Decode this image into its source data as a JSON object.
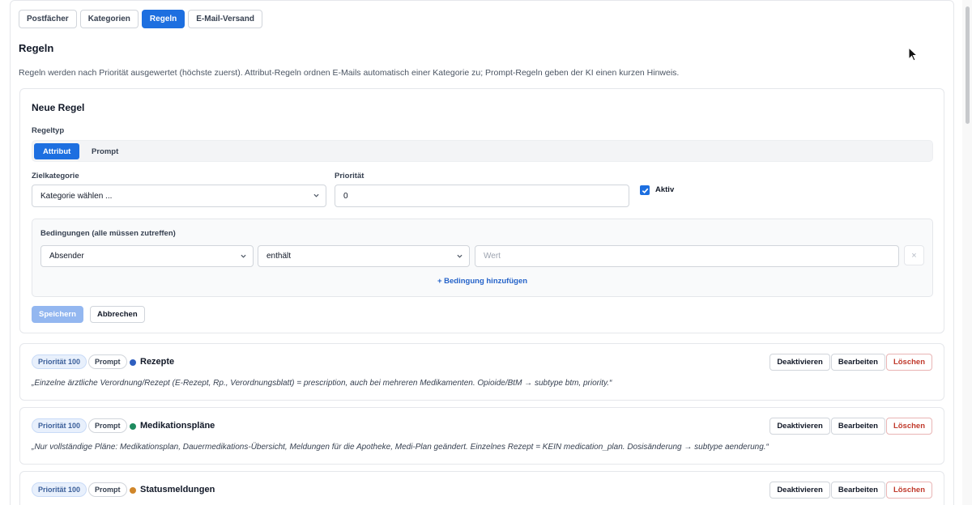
{
  "tabs": [
    {
      "label": "Postfächer",
      "active": false
    },
    {
      "label": "Kategorien",
      "active": false
    },
    {
      "label": "Regeln",
      "active": true
    },
    {
      "label": "E-Mail-Versand",
      "active": false
    }
  ],
  "page": {
    "title": "Regeln",
    "description": "Regeln werden nach Priorität ausgewertet (höchste zuerst). Attribut-Regeln ordnen E-Mails automatisch einer Kategorie zu; Prompt-Regeln geben der KI einen kurzen Hinweis."
  },
  "new_rule": {
    "title": "Neue Regel",
    "type_label": "Regeltyp",
    "type_options": [
      "Attribut",
      "Prompt"
    ],
    "type_selected": "Attribut",
    "category_label": "Zielkategorie",
    "category_value": "Kategorie wählen ...",
    "priority_label": "Priorität",
    "priority_value": "0",
    "active_label": "Aktiv",
    "active_checked": true,
    "conditions_label": "Bedingungen (alle müssen zutreffen)",
    "condition": {
      "field": "Absender",
      "operator": "enthält",
      "value_placeholder": "Wert",
      "remove_symbol": "×"
    },
    "add_condition": "+ Bedingung hinzufügen",
    "save": "Speichern",
    "cancel": "Abbrechen"
  },
  "rule_actions": {
    "deactivate": "Deaktivieren",
    "edit": "Bearbeiten",
    "delete": "Löschen"
  },
  "rules": [
    {
      "priority": "Priorität 100",
      "kind": "Prompt",
      "name": "Rezepte",
      "color": "#2f5fbf",
      "text": "„Einzelne ärztliche Verordnung/Rezept (E-Rezept, Rp., Verordnungsblatt) = prescription, auch bei mehreren Medikamenten. Opioide/BtM → subtype btm, priority.“"
    },
    {
      "priority": "Priorität 100",
      "kind": "Prompt",
      "name": "Medikationspläne",
      "color": "#1e8a5e",
      "text": "„Nur vollständige Pläne: Medikationsplan, Dauermedikations-Übersicht, Meldungen für die Apotheke, Medi-Plan geändert. Einzelnes Rezept = KEIN medication_plan. Dosisänderung → subtype aenderung.“"
    },
    {
      "priority": "Priorität 100",
      "kind": "Prompt",
      "name": "Statusmeldungen",
      "color": "#d0862a",
      "text": ""
    }
  ]
}
